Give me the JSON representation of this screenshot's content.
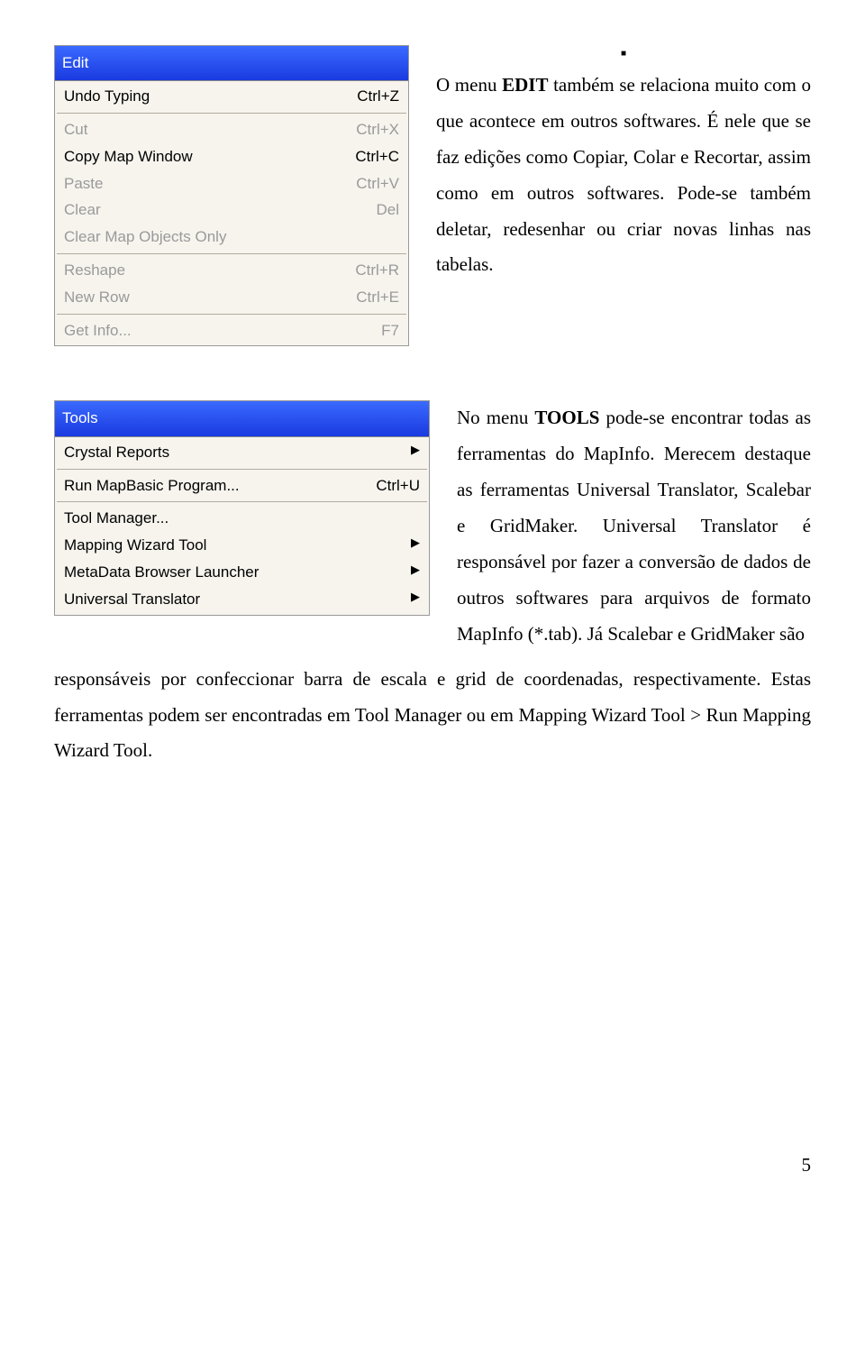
{
  "bullet": "■",
  "edit_menu": {
    "title": "Edit",
    "items": [
      {
        "label": "Undo Typing",
        "shortcut": "Ctrl+Z",
        "disabled": false
      },
      "sep",
      {
        "label": "Cut",
        "shortcut": "Ctrl+X",
        "disabled": true
      },
      {
        "label": "Copy Map Window",
        "shortcut": "Ctrl+C",
        "disabled": false
      },
      {
        "label": "Paste",
        "shortcut": "Ctrl+V",
        "disabled": true
      },
      {
        "label": "Clear",
        "shortcut": "Del",
        "disabled": true
      },
      {
        "label": "Clear Map Objects Only",
        "shortcut": "",
        "disabled": true
      },
      "sep",
      {
        "label": "Reshape",
        "shortcut": "Ctrl+R",
        "disabled": true
      },
      {
        "label": "New Row",
        "shortcut": "Ctrl+E",
        "disabled": true
      },
      "sep",
      {
        "label": "Get Info...",
        "shortcut": "F7",
        "disabled": true
      }
    ]
  },
  "para1": {
    "t1": "O menu ",
    "b1": "EDIT",
    "t2": " também se relaciona muito com o que acontece em outros softwares. É nele que se faz edições como Copiar, Colar e Recortar, assim como em outros softwares. Pode-se também deletar, redesenhar ou criar novas linhas nas tabelas."
  },
  "tools_menu": {
    "title": "Tools",
    "items": [
      {
        "label": "Crystal Reports",
        "submenu": true,
        "disabled": false
      },
      "sep",
      {
        "label": "Run MapBasic Program...",
        "shortcut": "Ctrl+U",
        "disabled": false
      },
      "sep",
      {
        "label": "Tool Manager...",
        "disabled": false
      },
      {
        "label": "Mapping Wizard Tool",
        "submenu": true,
        "disabled": false
      },
      {
        "label": "MetaData Browser Launcher",
        "submenu": true,
        "disabled": false
      },
      {
        "label": "Universal Translator",
        "submenu": true,
        "disabled": false
      }
    ]
  },
  "para2": {
    "t1": "No menu ",
    "b1": "TOOLS",
    "t2": " pode-se encontrar todas as ferramentas do MapInfo. Merecem destaque as ferramentas Universal Translator, Scalebar e GridMaker. Universal Translator é responsável por fazer a conversão de dados de outros softwares para arquivos de formato MapInfo (*.tab). Já Scalebar e GridMaker são"
  },
  "para2_cont": "responsáveis por confeccionar barra de escala e grid de coordenadas, respectivamente. Estas ferramentas podem ser encontradas em Tool Manager ou em Mapping Wizard Tool > Run Mapping Wizard Tool.",
  "page_number": "5"
}
